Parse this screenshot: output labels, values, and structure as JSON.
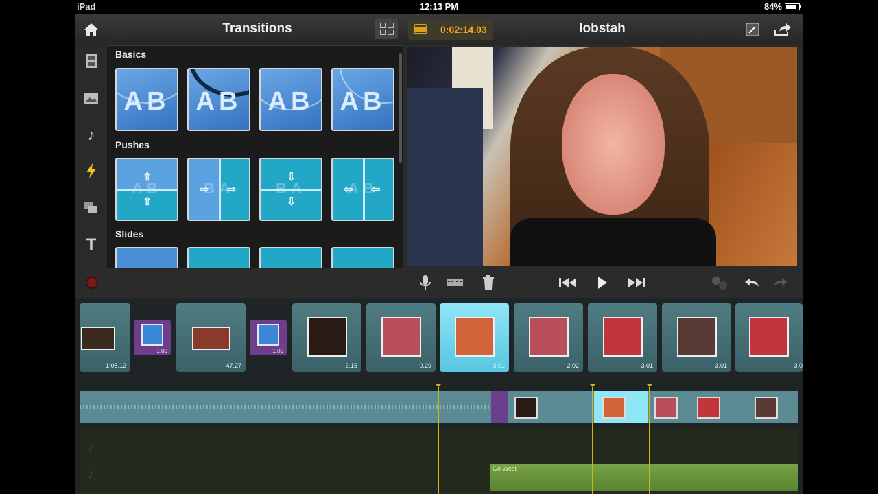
{
  "status": {
    "device": "iPad",
    "time": "12:13 PM",
    "battery": "84%",
    "battery_level": 0.84
  },
  "toolbar": {
    "panel_title": "Transitions",
    "timecode": "0:02:14.03",
    "project_title": "lobstah"
  },
  "icons": {
    "home": "home-icon",
    "film": "film-icon",
    "photo": "photo-icon",
    "music": "music-note-icon",
    "transitions": "lightning-icon",
    "overlay": "overlay-icon",
    "titles": "text-icon",
    "edit": "pencil-icon",
    "share": "share-icon"
  },
  "sections": [
    {
      "title": "Basics"
    },
    {
      "title": "Pushes"
    },
    {
      "title": "Slides"
    }
  ],
  "basic_thumbs": [
    {
      "letters": "AB"
    },
    {
      "letters": "AB"
    },
    {
      "letters": "AB"
    },
    {
      "letters": "AB"
    }
  ],
  "push_thumbs": [
    {
      "letters": "AB"
    },
    {
      "letters": "BA"
    },
    {
      "letters": "BA"
    },
    {
      "letters": "AB"
    }
  ],
  "storyboard": {
    "clips": [
      {
        "duration": "1:08.12"
      },
      {
        "duration": "1.00",
        "kind": "transition"
      },
      {
        "duration": "47.27"
      },
      {
        "duration": "1.00",
        "kind": "transition"
      },
      {
        "duration": "3.15"
      },
      {
        "duration": "0.29"
      },
      {
        "duration": "3.01",
        "selected": true
      },
      {
        "duration": "2.02"
      },
      {
        "duration": "3.01"
      },
      {
        "duration": "3.01"
      },
      {
        "duration": "3.0"
      }
    ]
  },
  "timeline": {
    "music_label": "Go West"
  },
  "colors": {
    "accent": "#f2a516",
    "transition_purple": "#6e3d8c",
    "selected_clip": "#8ee6f7",
    "music_green": "#78a346"
  }
}
